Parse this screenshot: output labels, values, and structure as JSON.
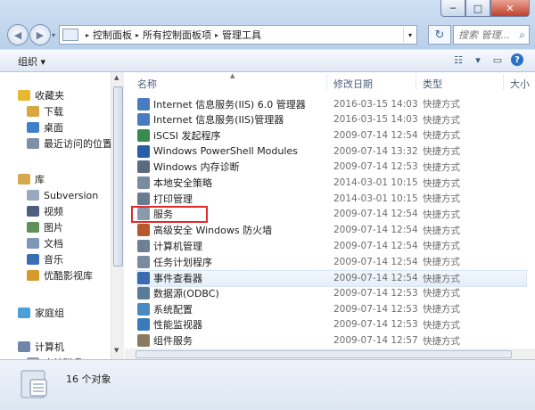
{
  "titlebar": {
    "min_label": "─",
    "max_label": "□",
    "close_label": "✕"
  },
  "address": {
    "crumbs": [
      "控制面板",
      "所有控制面板项",
      "管理工具"
    ],
    "separator": "▸",
    "search_placeholder": "搜索 管理..."
  },
  "toolbar": {
    "organize_label": "组织 ▾",
    "help_label": "?"
  },
  "navpane": {
    "items": [
      {
        "label": "收藏夹",
        "icon": "star-icon",
        "color": "#e8b830"
      },
      {
        "label": "下载",
        "icon": "download-folder-icon",
        "color": "#d9a640"
      },
      {
        "label": "桌面",
        "icon": "desktop-icon",
        "color": "#3d7fc8"
      },
      {
        "label": "最近访问的位置",
        "icon": "recent-places-icon",
        "color": "#7f8fa6"
      },
      {
        "label": "库",
        "icon": "libraries-icon",
        "color": "#d7a94c"
      },
      {
        "label": "Subversion",
        "icon": "library-icon",
        "color": "#9aa9bd"
      },
      {
        "label": "视频",
        "icon": "video-icon",
        "color": "#4d5f7c"
      },
      {
        "label": "图片",
        "icon": "pictures-icon",
        "color": "#5f8f5a"
      },
      {
        "label": "文档",
        "icon": "documents-icon",
        "color": "#7f98b8"
      },
      {
        "label": "音乐",
        "icon": "music-icon",
        "color": "#3b6db2"
      },
      {
        "label": "优酷影视库",
        "icon": "youku-library-icon",
        "color": "#d69a2a"
      },
      {
        "label": "家庭组",
        "icon": "homegroup-icon",
        "color": "#4aa0d8"
      },
      {
        "label": "计算机",
        "icon": "computer-icon",
        "color": "#6f86a6"
      },
      {
        "label": "本地磁盘 (C:)",
        "icon": "drive-icon",
        "color": "#8e9bad"
      }
    ]
  },
  "filelist": {
    "columns": {
      "name": "名称",
      "date": "修改日期",
      "type": "类型",
      "size": "大小"
    },
    "rows": [
      {
        "name": "Internet 信息服务(IIS) 6.0 管理器",
        "date": "2016-03-15 14:03",
        "type": "快捷方式",
        "color": "#4a7bc0"
      },
      {
        "name": "Internet 信息服务(IIS)管理器",
        "date": "2016-03-15 14:03",
        "type": "快捷方式",
        "color": "#4a7bc0"
      },
      {
        "name": "iSCSI 发起程序",
        "date": "2009-07-14 12:54",
        "type": "快捷方式",
        "color": "#3a8a50"
      },
      {
        "name": "Windows PowerShell Modules",
        "date": "2009-07-14 13:32",
        "type": "快捷方式",
        "color": "#2a5ca8"
      },
      {
        "name": "Windows 内存诊断",
        "date": "2009-07-14 12:53",
        "type": "快捷方式",
        "color": "#5a6a80"
      },
      {
        "name": "本地安全策略",
        "date": "2014-03-01 10:15",
        "type": "快捷方式",
        "color": "#7a8aa0"
      },
      {
        "name": "打印管理",
        "date": "2014-03-01 10:15",
        "type": "快捷方式",
        "color": "#6a7a8f"
      },
      {
        "name": "服务",
        "date": "2009-07-14 12:54",
        "type": "快捷方式",
        "color": "#8a9aac"
      },
      {
        "name": "高级安全 Windows 防火墙",
        "date": "2009-07-14 12:54",
        "type": "快捷方式",
        "color": "#b8582f"
      },
      {
        "name": "计算机管理",
        "date": "2009-07-14 12:54",
        "type": "快捷方式",
        "color": "#6f7f95"
      },
      {
        "name": "任务计划程序",
        "date": "2009-07-14 12:54",
        "type": "快捷方式",
        "color": "#7a8aa0"
      },
      {
        "name": "事件查看器",
        "date": "2009-07-14 12:54",
        "type": "快捷方式",
        "color": "#3a6ab0"
      },
      {
        "name": "数据源(ODBC)",
        "date": "2009-07-14 12:53",
        "type": "快捷方式",
        "color": "#5a7a9a"
      },
      {
        "name": "系统配置",
        "date": "2009-07-14 12:53",
        "type": "快捷方式",
        "color": "#4a8ac0"
      },
      {
        "name": "性能监视器",
        "date": "2009-07-14 12:53",
        "type": "快捷方式",
        "color": "#3a7ab8"
      },
      {
        "name": "组件服务",
        "date": "2009-07-14 12:57",
        "type": "快捷方式",
        "color": "#8a7a60"
      }
    ]
  },
  "status": {
    "count_label": "16 个对象"
  },
  "colors": {
    "highlight": "#e0292b",
    "selection": "#e4eef9"
  }
}
